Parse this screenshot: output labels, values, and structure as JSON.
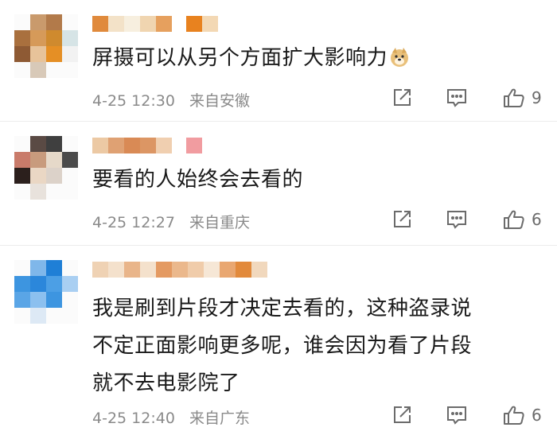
{
  "comments": [
    {
      "text": "屏摄可以从另个方面扩大影响力",
      "emoji": "doge-emoji",
      "date": "4-25",
      "time": "12:30",
      "location": "来自安徽",
      "likes": "9"
    },
    {
      "text": "要看的人始终会去看的",
      "date": "4-25",
      "time": "12:27",
      "location": "来自重庆",
      "likes": "6"
    },
    {
      "lines": [
        "我是刷到片段才决定去看的，这种盗录说",
        "不定正面影响更多呢，谁会因为看了片段",
        "就不去电影院了"
      ],
      "date": "4-25",
      "time": "12:40",
      "location": "来自广东",
      "likes": "6"
    }
  ],
  "icons": {
    "share": "share-icon",
    "reply": "comment-icon",
    "like": "thumbs-up-icon"
  },
  "colors": {
    "text": "#1a1a1a",
    "meta": "#8a8a8a",
    "icon": "#6b6b6b"
  }
}
